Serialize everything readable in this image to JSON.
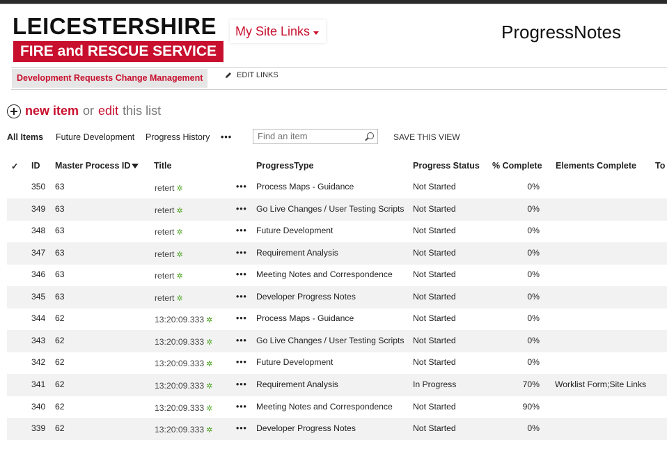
{
  "header": {
    "logo_line1": "LEICESTERSHIRE",
    "logo_line2": "FIRE and RESCUE SERVICE",
    "site_links": "My Site Links",
    "page_title": "ProgressNotes"
  },
  "nav": {
    "item": "Development Requests Change Management",
    "edit_links": "EDIT LINKS"
  },
  "actions": {
    "new_item": "new item",
    "or": "or",
    "edit": "edit",
    "this_list": "this list"
  },
  "views": {
    "all_items": "All Items",
    "future_development": "Future Development",
    "progress_history": "Progress History",
    "more": "•••",
    "search_placeholder": "Find an item",
    "save_view": "SAVE THIS VIEW"
  },
  "table": {
    "columns": [
      "✓",
      "ID",
      "Master Process ID",
      "Title",
      "ProgressType",
      "Progress Status",
      "% Complete",
      "Elements Complete",
      "To"
    ],
    "rows": [
      {
        "id": "350",
        "master": "63",
        "title": "retert",
        "type": "Process Maps - Guidance",
        "status": "Not Started",
        "pct": "0%",
        "elements": ""
      },
      {
        "id": "349",
        "master": "63",
        "title": "retert",
        "type": "Go Live Changes / User Testing Scripts",
        "status": "Not Started",
        "pct": "0%",
        "elements": ""
      },
      {
        "id": "348",
        "master": "63",
        "title": "retert",
        "type": "Future Development",
        "status": "Not Started",
        "pct": "0%",
        "elements": ""
      },
      {
        "id": "347",
        "master": "63",
        "title": "retert",
        "type": "Requirement Analysis",
        "status": "Not Started",
        "pct": "0%",
        "elements": ""
      },
      {
        "id": "346",
        "master": "63",
        "title": "retert",
        "type": "Meeting Notes and Correspondence",
        "status": "Not Started",
        "pct": "0%",
        "elements": ""
      },
      {
        "id": "345",
        "master": "63",
        "title": "retert",
        "type": "Developer Progress Notes",
        "status": "Not Started",
        "pct": "0%",
        "elements": ""
      },
      {
        "id": "344",
        "master": "62",
        "title": "13:20:09.333",
        "type": "Process Maps - Guidance",
        "status": "Not Started",
        "pct": "0%",
        "elements": ""
      },
      {
        "id": "343",
        "master": "62",
        "title": "13:20:09.333",
        "type": "Go Live Changes / User Testing Scripts",
        "status": "Not Started",
        "pct": "0%",
        "elements": ""
      },
      {
        "id": "342",
        "master": "62",
        "title": "13:20:09.333",
        "type": "Future Development",
        "status": "Not Started",
        "pct": "0%",
        "elements": ""
      },
      {
        "id": "341",
        "master": "62",
        "title": "13:20:09.333",
        "type": "Requirement Analysis",
        "status": "In Progress",
        "pct": "70%",
        "elements": "Worklist Form;Site Links"
      },
      {
        "id": "340",
        "master": "62",
        "title": "13:20:09.333",
        "type": "Meeting Notes and Correspondence",
        "status": "Not Started",
        "pct": "90%",
        "elements": ""
      },
      {
        "id": "339",
        "master": "62",
        "title": "13:20:09.333",
        "type": "Developer Progress Notes",
        "status": "Not Started",
        "pct": "0%",
        "elements": ""
      }
    ]
  },
  "colors": {
    "brand_red": "#c8102e",
    "new_icon_green": "#4aa31e",
    "row_alt": "#f2f2f2"
  },
  "icons": [
    "plus-circle-icon",
    "pencil-icon",
    "search-icon",
    "filter-icon",
    "new-item-icon",
    "ellipsis-icon",
    "caret-down-icon"
  ]
}
